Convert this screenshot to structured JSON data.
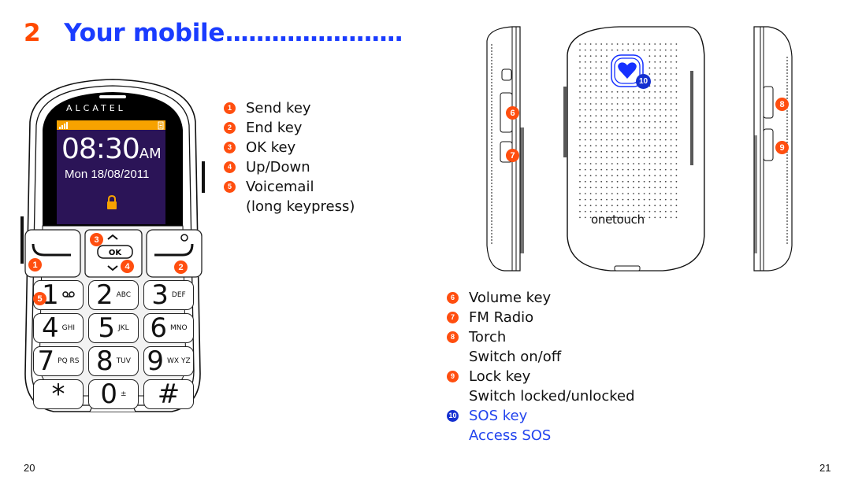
{
  "heading": {
    "number": "2",
    "title": "Your mobile",
    "leader": "......................."
  },
  "phone_front": {
    "brand": "ALCATEL",
    "time": "08:30",
    "ampm": "AM",
    "date": "Mon 18/08/2011",
    "screen_color": "#2b1457",
    "status_bar_color": "#f7a200",
    "icons": [
      "signal-icon",
      "battery-icon",
      "lock-icon"
    ],
    "nav_key_label": "OK",
    "keypad": [
      {
        "digit": "1",
        "letters": "voicemail"
      },
      {
        "digit": "2",
        "letters": "ABC"
      },
      {
        "digit": "3",
        "letters": "DEF"
      },
      {
        "digit": "4",
        "letters": "GHI"
      },
      {
        "digit": "5",
        "letters": "JKL"
      },
      {
        "digit": "6",
        "letters": "MNO"
      },
      {
        "digit": "7",
        "letters": "PQ RS"
      },
      {
        "digit": "8",
        "letters": "TUV"
      },
      {
        "digit": "9",
        "letters": "WX YZ"
      },
      {
        "digit": "*",
        "letters": ""
      },
      {
        "digit": "0",
        "letters": "±"
      },
      {
        "digit": "#",
        "letters": ""
      }
    ]
  },
  "phone_back": {
    "logo": "onetouch"
  },
  "callouts": [
    "1",
    "2",
    "3",
    "4",
    "5",
    "6",
    "7",
    "8",
    "9",
    "10"
  ],
  "legend_left": [
    {
      "n": "1",
      "lines": [
        "Send key"
      ]
    },
    {
      "n": "2",
      "lines": [
        "End key"
      ]
    },
    {
      "n": "3",
      "lines": [
        "OK key"
      ]
    },
    {
      "n": "4",
      "lines": [
        "Up/Down"
      ]
    },
    {
      "n": "5",
      "lines": [
        "Voicemail",
        "(long keypress)"
      ]
    }
  ],
  "legend_right": [
    {
      "n": "6",
      "lines": [
        "Volume key"
      ]
    },
    {
      "n": "7",
      "lines": [
        "FM Radio"
      ]
    },
    {
      "n": "8",
      "lines": [
        "Torch",
        "Switch on/off"
      ]
    },
    {
      "n": "9",
      "lines": [
        "Lock key",
        "Switch locked/unlocked"
      ]
    },
    {
      "n": "10",
      "lines": [
        "SOS key",
        "Access SOS"
      ],
      "highlight": true
    }
  ],
  "page_numbers": {
    "left": "20",
    "right": "21"
  },
  "colors": {
    "accent_orange": "#ff4e0f",
    "accent_blue": "#1a3cff"
  }
}
